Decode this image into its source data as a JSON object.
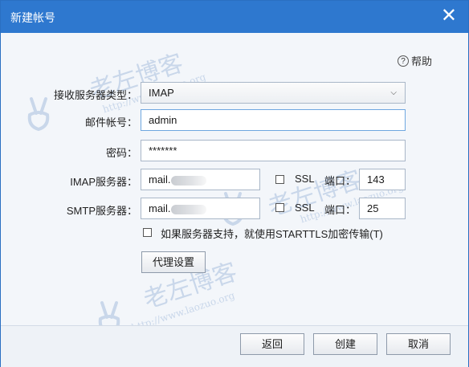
{
  "dialog": {
    "title": "新建帐号",
    "close_symbol": "✕",
    "help_label": "帮助",
    "help_symbol": "?"
  },
  "form": {
    "server_type_label": "接收服务器类型：",
    "server_type_value": "IMAP",
    "account_label": "邮件帐号：",
    "account_value": "admin",
    "password_label": "密码：",
    "password_value": "*******",
    "imap_label": "IMAP服务器：",
    "imap_value": "mail.",
    "smtp_label": "SMTP服务器：",
    "smtp_value": "mail.",
    "ssl_label": "SSL",
    "port_label": "端口：",
    "imap_port": "143",
    "smtp_port": "25",
    "starttls_label": "如果服务器支持，就使用STARTTLS加密传输(T)",
    "proxy_button": "代理设置"
  },
  "footer": {
    "back_button": "返回",
    "create_button": "创建",
    "cancel_button": "取消"
  },
  "watermark": {
    "text": "老左博客",
    "url": "http://www.laozuo.org"
  },
  "colors": {
    "titlebar": "#2e78cf",
    "dialog_bg": "#f3f6fa",
    "watermark": "#c9d7ea"
  }
}
